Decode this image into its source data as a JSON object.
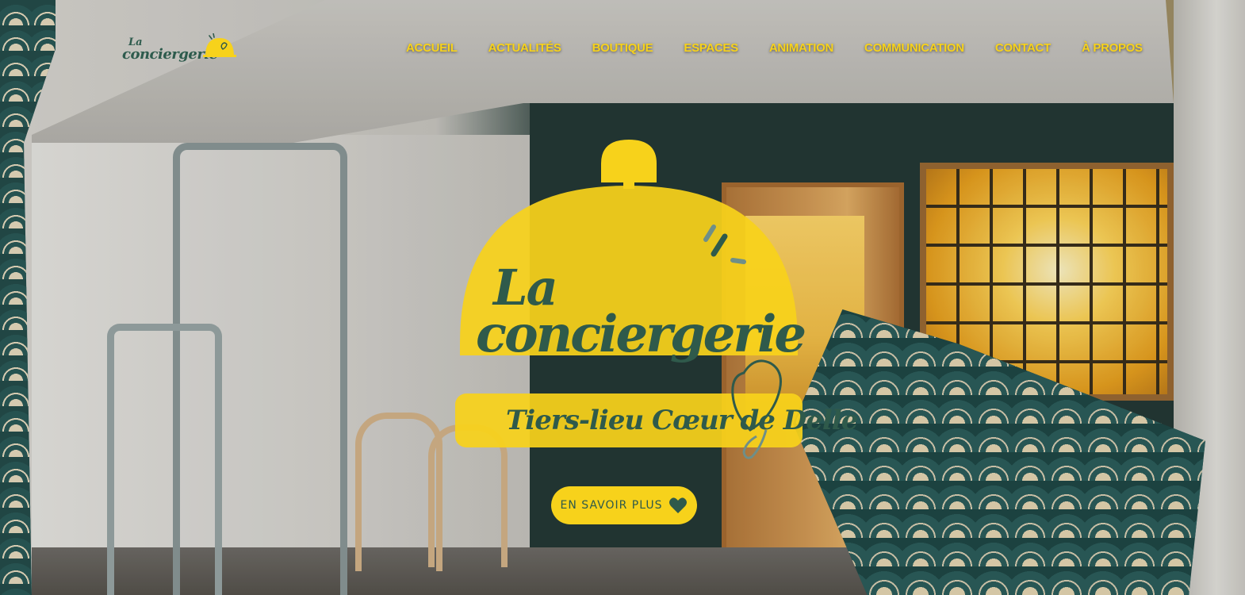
{
  "site": {
    "logo": {
      "line1": "La",
      "line2": "conciergerie"
    }
  },
  "nav": {
    "items": [
      {
        "label": "ACCUEIL"
      },
      {
        "label": "ACTUALITÉS"
      },
      {
        "label": "BOUTIQUE"
      },
      {
        "label": "ESPACES"
      },
      {
        "label": "ANIMATION"
      },
      {
        "label": "COMMUNICATION"
      },
      {
        "label": "CONTACT"
      },
      {
        "label": "À PROPOS"
      }
    ]
  },
  "hero": {
    "logo_line1": "La",
    "logo_line2": "conciergerie",
    "tagline": "Tiers-lieu Cœur de Delle",
    "cta_label": "EN SAVOIR PLUS",
    "cta_icon": "heart-icon"
  },
  "colors": {
    "brand_yellow": "#f7d21b",
    "brand_green": "#2f5a4b",
    "accent_teal": "#6f8f88"
  }
}
